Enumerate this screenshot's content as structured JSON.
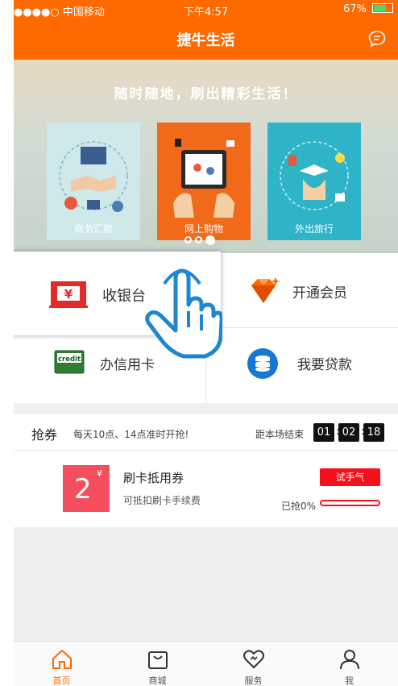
{
  "status": {
    "carrier": "●●●●○ 中国移动",
    "time": "下午4:57",
    "battery": "67%",
    "battery_level": 0.67
  },
  "nav": {
    "title": "捷牛生活",
    "message_icon": "chat-bubble-icon"
  },
  "banner": {
    "tagline": "随时随地，刷出精彩生活！",
    "cards": [
      {
        "label": "商务汇款",
        "color": "#cfe9ea"
      },
      {
        "label": "网上购物",
        "color": "#f06a1a"
      },
      {
        "label": "外出旅行",
        "color": "#2fb3c6"
      }
    ],
    "dots_count": 3,
    "active_dot": 3
  },
  "quick": {
    "cashier": "收银台",
    "member": "开通会员",
    "credit_card": "办信用卡",
    "credit_icon_text": "credit",
    "loan": "我要贷款"
  },
  "coupon_section": {
    "title": "抢券",
    "schedule": "每天10点、14点准时开抢!",
    "ends_label": "距本场结束",
    "hours": "01",
    "minutes": "02",
    "seconds": "18"
  },
  "coupon": {
    "value": "2",
    "currency": "¥",
    "name": "刷卡抵用券",
    "desc": "可抵扣刷卡手续费",
    "button": "试手气",
    "progress_label": "已抢0%",
    "progress": 0
  },
  "tabs": [
    {
      "label": "首页",
      "icon": "home-icon"
    },
    {
      "label": "商城",
      "icon": "shopping-bag-icon"
    },
    {
      "label": "服务",
      "icon": "heart-icon"
    },
    {
      "label": "我",
      "icon": "person-icon"
    }
  ],
  "colors": {
    "brand": "#ff6a00",
    "accent_red": "#f5101e",
    "coupon_red": "#f54e5e"
  }
}
